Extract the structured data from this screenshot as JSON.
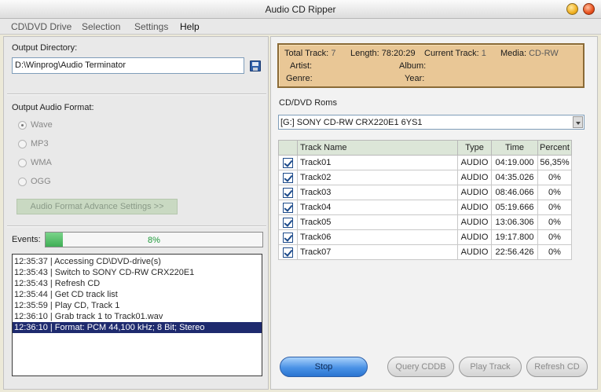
{
  "window": {
    "title": "Audio CD Ripper"
  },
  "menu": [
    "CD\\DVD Drive",
    "Selection",
    "Settings",
    "Help"
  ],
  "output": {
    "directory_label": "Output Directory:",
    "directory_value": "D:\\Winprog\\Audio Terminator",
    "format_label": "Output Audio Format:",
    "formats": [
      "Wave",
      "MP3",
      "WMA",
      "OGG"
    ],
    "selected_format": "Wave",
    "advance_button": "Audio Format Advance Settings >>"
  },
  "events": {
    "label": "Events:",
    "progress_text": "8%",
    "progress_fraction": 0.08,
    "log": [
      "12:35:37 | Accessing CD\\DVD-drive(s)",
      "12:35:43 | Switch to SONY     CD-RW  CRX220E1",
      "12:35:43 | Refresh CD",
      "12:35:44 | Get CD track list",
      "12:35:59 | Play CD, Track 1",
      "12:36:10 | Grab track 1 to Track01.wav",
      "12:36:10 | Format: PCM 44,100 kHz; 8 Bit; Stereo"
    ],
    "selected_index": 6
  },
  "info": {
    "total_track_label": "Total Track:",
    "total_track": "7",
    "length_label": "Length:",
    "length": "78:20:29",
    "current_track_label": "Current Track:",
    "current_track": "1",
    "media_label": "Media:",
    "media": "CD-RW",
    "artist_label": "Artist:",
    "album_label": "Album:",
    "genre_label": "Genre:",
    "year_label": "Year:"
  },
  "drives": {
    "label": "CD/DVD Roms",
    "selected": "[G:]  SONY      CD-RW  CRX220E1    6YS1"
  },
  "table": {
    "headers": [
      "Track Name",
      "Type",
      "Time",
      "Percent"
    ],
    "rows": [
      {
        "name": "Track01",
        "type": "AUDIO",
        "time": "04:19.000",
        "percent": "56,35%"
      },
      {
        "name": "Track02",
        "type": "AUDIO",
        "time": "04:35.026",
        "percent": "0%"
      },
      {
        "name": "Track03",
        "type": "AUDIO",
        "time": "08:46.066",
        "percent": "0%"
      },
      {
        "name": "Track04",
        "type": "AUDIO",
        "time": "05:19.666",
        "percent": "0%"
      },
      {
        "name": "Track05",
        "type": "AUDIO",
        "time": "13:06.306",
        "percent": "0%"
      },
      {
        "name": "Track06",
        "type": "AUDIO",
        "time": "19:17.800",
        "percent": "0%"
      },
      {
        "name": "Track07",
        "type": "AUDIO",
        "time": "22:56.426",
        "percent": "0%"
      }
    ]
  },
  "buttons": {
    "stop": "Stop",
    "query": "Query CDDB",
    "play": "Play Track",
    "refresh": "Refresh CD"
  },
  "colors": {
    "info_bg": "#e9c796",
    "selection": "#1e2a6e",
    "progress_green": "#3fae55",
    "stop_blue": "#4a92e6"
  }
}
